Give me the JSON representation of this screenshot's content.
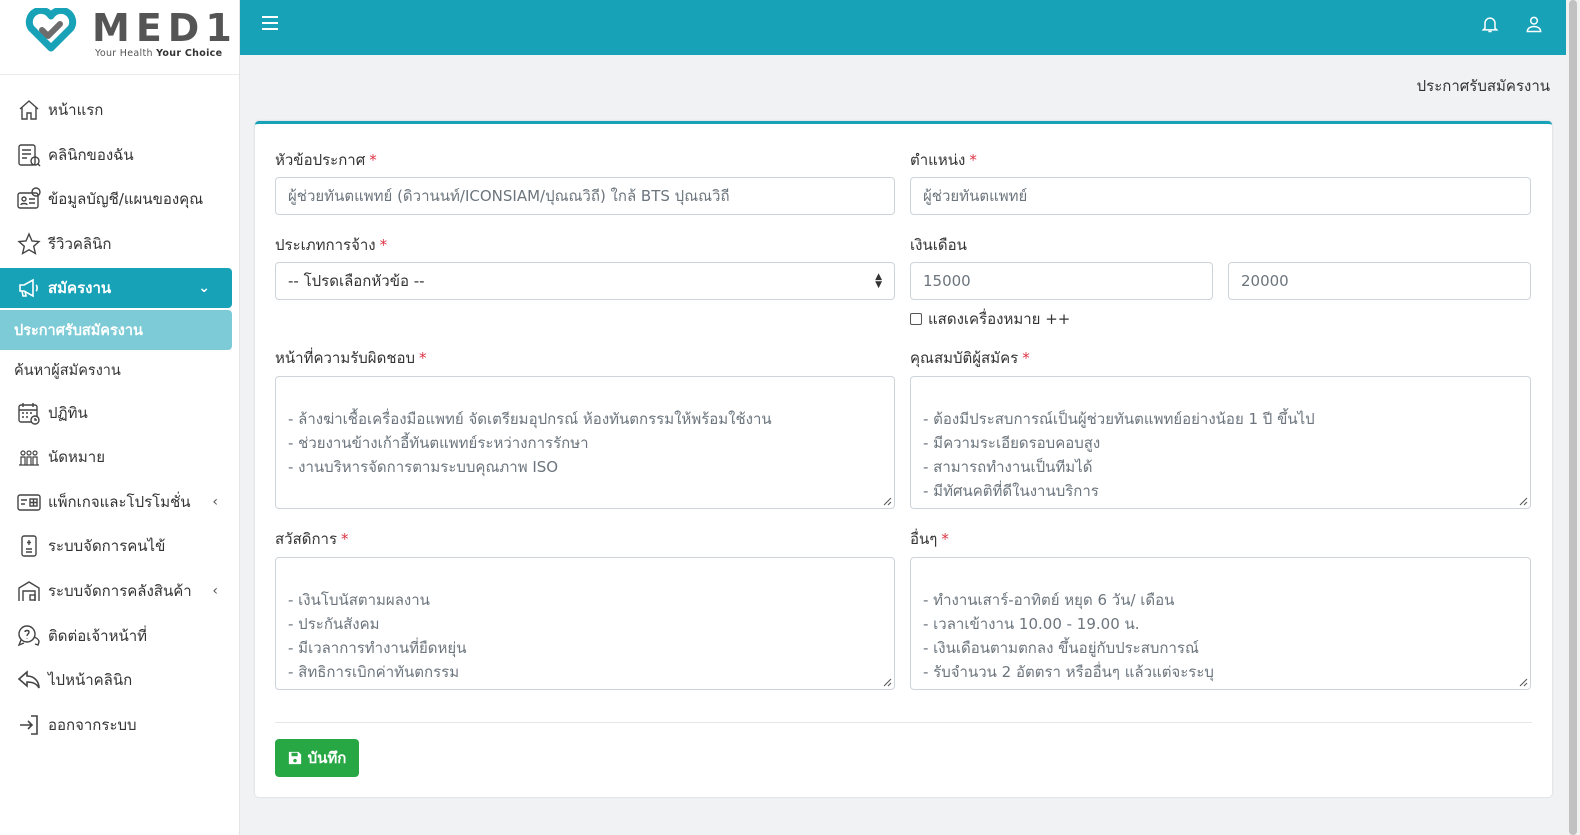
{
  "brand": {
    "name": "MED1",
    "tagline_prefix": "Your Health",
    "tagline_bold": "Your Choice"
  },
  "sidebar": {
    "items": [
      {
        "label": "หน้าแรก",
        "icon": "home-icon"
      },
      {
        "label": "คลินิกของฉัน",
        "icon": "clinic-list-icon"
      },
      {
        "label": "ข้อมูลบัญชี/แผนของคุณ",
        "icon": "account-card-icon"
      },
      {
        "label": "รีวิวคลินิก",
        "icon": "star-icon"
      },
      {
        "label": "สมัครงาน",
        "icon": "megaphone-icon"
      },
      {
        "label": "ประกาศรับสมัครงาน"
      },
      {
        "label": "ค้นหาผู้สมัครงาน"
      },
      {
        "label": "ปฏิทิน",
        "icon": "calendar-icon"
      },
      {
        "label": "นัดหมาย",
        "icon": "appointment-icon"
      },
      {
        "label": "แพ็กเกจและโปรโมชั่น",
        "icon": "package-icon"
      },
      {
        "label": "ระบบจัดการคนไข้",
        "icon": "patient-file-icon"
      },
      {
        "label": "ระบบจัดการคลังสินค้า",
        "icon": "warehouse-icon"
      },
      {
        "label": "ติดต่อเจ้าหน้าที่",
        "icon": "chat-icon"
      },
      {
        "label": "ไปหน้าคลินิก",
        "icon": "reply-icon"
      },
      {
        "label": "ออกจากระบบ",
        "icon": "logout-icon"
      }
    ]
  },
  "topbar": {
    "menu_icon": "hamburger-icon",
    "bell_icon": "bell-icon",
    "user_icon": "user-icon"
  },
  "breadcrumb": "ประกาศรับสมัครงาน",
  "form": {
    "title_label": "หัวข้อประกาศ",
    "title_value": "ผู้ช่วยทันตแพทย์ (ดิวานนท์/ICONSIAM/ปุณณวิถี) ใกล้ BTS ปุณณวิถี",
    "position_label": "ตำแหน่ง",
    "position_value": "ผู้ช่วยทันตแพทย์",
    "employment_label": "ประเภทการจ้าง",
    "employment_value": "-- โปรดเลือกหัวข้อ --",
    "salary_label": "เงินเดือน",
    "salary_min": "15000",
    "salary_max": "20000",
    "show_plus_label": "แสดงเครื่องหมาย ++",
    "duties_label": "หน้าที่ความรับผิดชอบ",
    "duties_value": "- ล้างฆ่าเชื้อเครื่องมือแพทย์ จัดเตรียมอุปกรณ์ ห้องทันตกรรมให้พร้อมใช้งาน\n- ช่วยงานข้างเก้าอี้ทันตแพทย์ระหว่างการรักษา\n- งานบริหารจัดการตามระบบคุณภาพ ISO",
    "qualifications_label": "คุณสมบัติผู้สมัคร",
    "qualifications_value": "- ต้องมีประสบการณ์เป็นผู้ช่วยทันตแพทย์อย่างน้อย 1 ปี ขึ้นไป\n- มีความระเอียดรอบคอบสูง\n- สามารถทำงานเป็นทีมได้\n- มีทัศนคติที่ดีในงานบริการ",
    "welfare_label": "สวัสดิการ",
    "welfare_value": "- เงินโบนัสตามผลงาน\n- ประกันสังคม\n- มีเวลาการทำงานที่ยืดหยุ่น\n- สิทธิการเบิกค่าทันตกรรม",
    "other_label": "อื่นๆ",
    "other_value": "- ทำงานเสาร์-อาทิตย์ หยุด 6 วัน/ เดือน\n- เวลาเข้างาน 10.00 - 19.00 น.\n- เงินเดือนตามตกลง ขึ้นอยู่กับประสบการณ์\n- รับจำนวน 2 อัตตรา หรืออื่นๆ แล้วแต่จะระบุ",
    "required_mark": "*",
    "save_label": "บันทึก"
  },
  "colors": {
    "accent": "#17a2b8",
    "active_sub": "#7ccbd6",
    "save": "#28a745",
    "required": "#dc3545"
  }
}
